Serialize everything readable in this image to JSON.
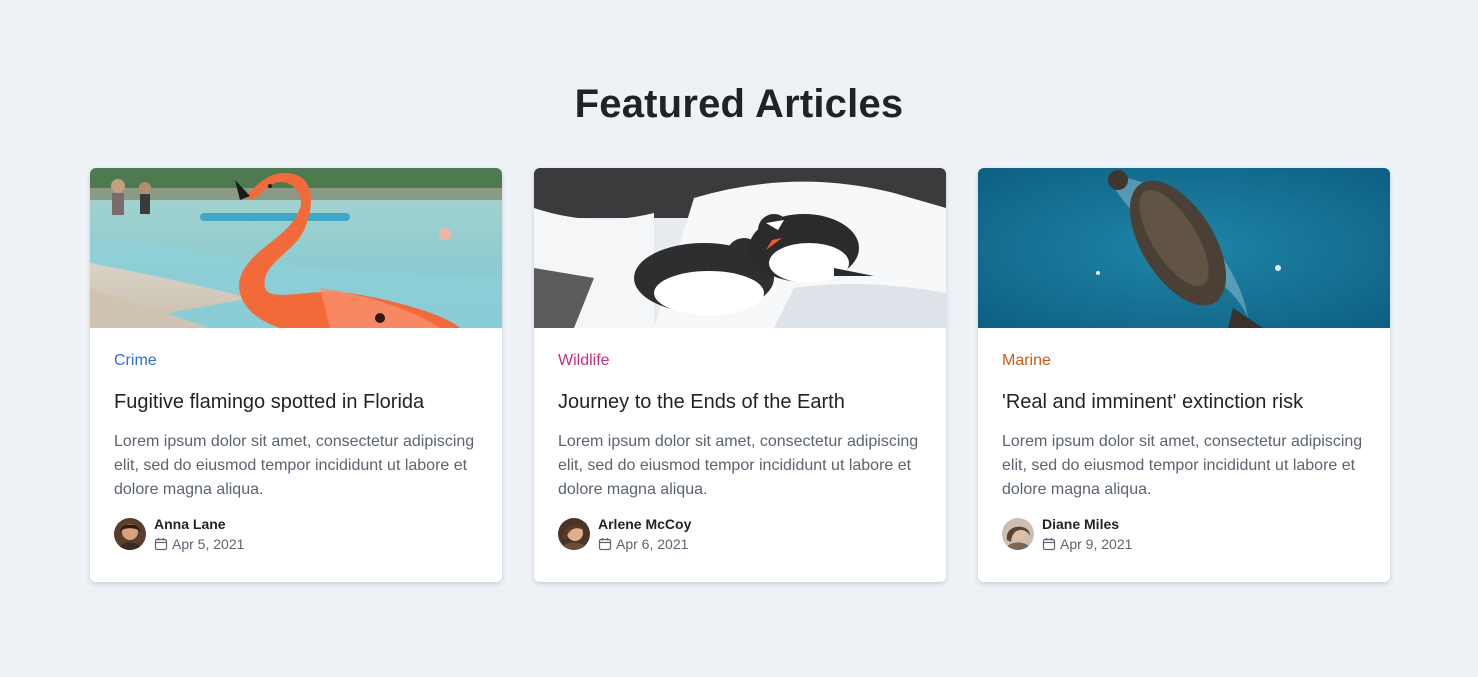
{
  "page": {
    "title": "Featured Articles"
  },
  "articles": [
    {
      "image": "flamingo-photo",
      "category": "Crime",
      "category_color": "#2f6fd1",
      "title": "Fugitive flamingo spotted in Florida",
      "excerpt": "Lorem ipsum dolor sit amet, consectetur adipiscing elit, sed do eiusmod tempor incididunt ut labore et dolore magna aliqua.",
      "author": "Anna Lane",
      "date": "Apr 5, 2021"
    },
    {
      "image": "penguins-photo",
      "category": "Wildlife",
      "category_color": "#c2307f",
      "title": "Journey to the Ends of the Earth",
      "excerpt": "Lorem ipsum dolor sit amet, consectetur adipiscing elit, sed do eiusmod tempor incididunt ut labore et dolore magna aliqua.",
      "author": "Arlene McCoy",
      "date": "Apr 6, 2021"
    },
    {
      "image": "seal-swimming-photo",
      "category": "Marine",
      "category_color": "#d4571c",
      "title": "'Real and imminent' extinction risk",
      "excerpt": "Lorem ipsum dolor sit amet, consectetur adipiscing elit, sed do eiusmod tempor incididunt ut labore et dolore magna aliqua.",
      "author": "Diane Miles",
      "date": "Apr 9, 2021"
    }
  ]
}
